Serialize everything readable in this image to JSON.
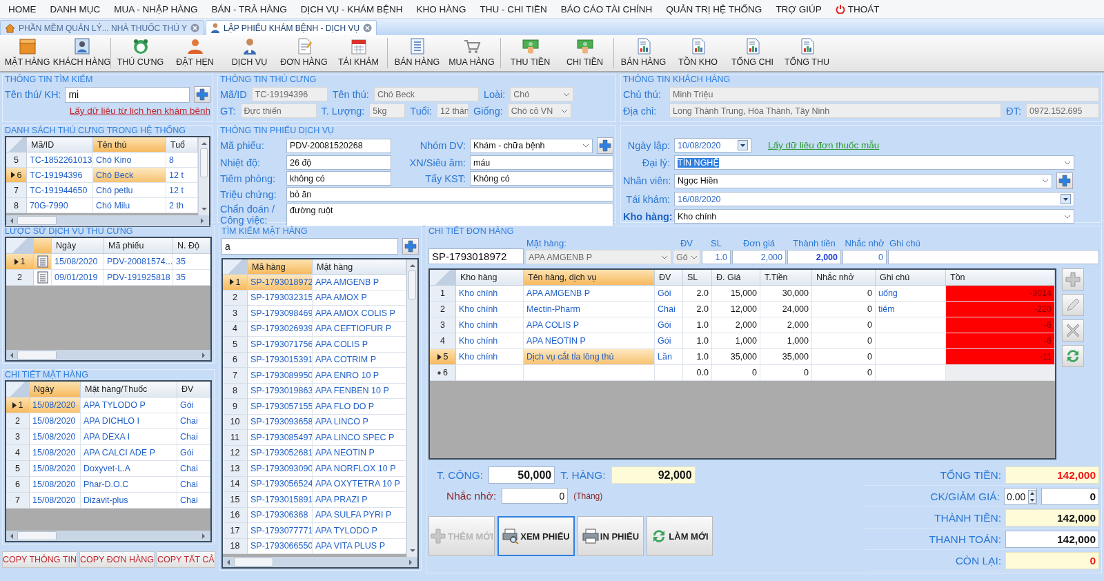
{
  "menu": {
    "items": [
      "HOME",
      "DANH MỤC",
      "MUA - NHẬP HÀNG",
      "BÁN - TRẢ HÀNG",
      "DỊCH VỤ - KHÁM BỆNH",
      "KHO HÀNG",
      "THU - CHI TIỀN",
      "BÁO CÁO TÀI CHÍNH",
      "QUẢN TRỊ HỆ THỐNG",
      "TRỢ GIÚP"
    ],
    "exit": "THOÁT"
  },
  "tabs": [
    {
      "label": "PHẦN MỀM QUẢN LÝ... NHÀ THUỐC THÚ Y",
      "kind": "home",
      "selected": false
    },
    {
      "label": "LẬP PHIẾU KHÁM BỆNH - DỊCH VỤ",
      "kind": "doctor",
      "selected": true
    }
  ],
  "toolbar": [
    [
      {
        "label": "MẶT HÀNG",
        "kind": "box"
      },
      {
        "label": "KHÁCH HÀNG",
        "kind": "card"
      }
    ],
    [
      {
        "label": "THÚ CƯNG",
        "kind": "pet"
      },
      {
        "label": "ĐẶT HẸN",
        "kind": "person"
      },
      {
        "label": "DỊCH VỤ",
        "kind": "doctor"
      },
      {
        "label": "ĐƠN HÀNG",
        "kind": "document"
      },
      {
        "label": "TÁI KHÁM",
        "kind": "calendar"
      }
    ],
    [
      {
        "label": "BÁN HÀNG",
        "kind": "list"
      },
      {
        "label": "MUA HÀNG",
        "kind": "cart"
      }
    ],
    [
      {
        "label": "THU TIỀN",
        "kind": "money"
      },
      {
        "label": "CHI TIỀN",
        "kind": "money"
      }
    ],
    [
      {
        "label": "BÁN HÀNG",
        "kind": "report"
      },
      {
        "label": "TỒN KHO",
        "kind": "report"
      },
      {
        "label": "TỔNG CHI",
        "kind": "report"
      },
      {
        "label": "TỔNG THU",
        "kind": "report"
      }
    ]
  ],
  "search_info": {
    "title": "THÔNG TIN TÌM KIẾM",
    "label": "Tên thú/ KH:",
    "value": "mi",
    "link": "Lấy dữ liêu từ lich hen khám bênh"
  },
  "pet_info": {
    "title": "THÔNG TIN THÚ CƯNG",
    "fields": [
      {
        "label": "Mã/ID",
        "value": "TC-19194396",
        "kind": "readonly"
      },
      {
        "label": "Tên thú:",
        "value": "Chó Beck",
        "kind": "readonly"
      },
      {
        "label": "Loài:",
        "value": "Chó",
        "kind": "readonly-select"
      },
      {
        "label": "GT:",
        "value": "Đực thiến",
        "kind": "readonly"
      },
      {
        "label": "T. Lượng:",
        "value": "5kg",
        "kind": "readonly"
      },
      {
        "label": "Tuổi:",
        "value": "12 thán",
        "kind": "readonly"
      },
      {
        "label": "Giống:",
        "value": "Chó cỏ VN",
        "kind": "readonly-select"
      }
    ]
  },
  "customer_info": {
    "title": "THÔNG TIN KHÁCH HÀNG",
    "fields": [
      {
        "label": "Chủ thú:",
        "value": "Minh Triệu",
        "kind": "readonly"
      },
      {
        "label": "Địa chỉ:",
        "value": "Long Thành Trung, Hòa Thành, Tây Ninh",
        "kind": "readonly"
      },
      {
        "label": "ĐT:",
        "value": "0972.152.695",
        "kind": "readonly"
      }
    ]
  },
  "pet_list": {
    "title": "DANH SÁCH THÚ CƯNG TRONG HỆ THỐNG",
    "columns": [
      {
        "label": "Mã/ID",
        "kind": "text",
        "current": false
      },
      {
        "label": "Tên thú",
        "kind": "text",
        "current": true
      },
      {
        "label": "Tuổ",
        "kind": "text",
        "current": false
      }
    ],
    "rows": [
      {
        "number": "5",
        "selected": false,
        "cells": [
          "TC-1852261013",
          "Chó Kino",
          "8"
        ]
      },
      {
        "number": "6",
        "selected": true,
        "cells": [
          "TC-19194396",
          "Chó Beck",
          "12 t"
        ]
      },
      {
        "number": "7",
        "selected": false,
        "cells": [
          "TC-191944650",
          "Chó petlu",
          "12 t"
        ]
      },
      {
        "number": "8",
        "selected": false,
        "cells": [
          "70G-7990",
          "Chó Milu",
          "2 th"
        ]
      }
    ]
  },
  "service_info": {
    "title": "THÔNG TIN PHIẾU DỊCH VỤ",
    "fields": [
      {
        "label": "Mã phiếu:",
        "value": "PDV-20081520268",
        "kind": "text"
      },
      {
        "label": "Nhóm DV:",
        "value": "Khám - chữa bệnh",
        "kind": "select",
        "add_button": true
      },
      {
        "label": "Nhiệt độ:",
        "value": "26 độ",
        "kind": "text"
      },
      {
        "label": "XN/Siêu âm:",
        "value": "máu",
        "kind": "text"
      },
      {
        "label": "Tiêm phòng:",
        "value": "không có",
        "kind": "text"
      },
      {
        "label": "Tẩy KST:",
        "value": "Không có",
        "kind": "text"
      },
      {
        "label": "Triệu chứng:",
        "value": "bỏ ăn",
        "kind": "text"
      },
      {
        "label": "Chẩn đoán / Công việc:",
        "value": "đường ruột",
        "kind": "textarea"
      }
    ],
    "template_link": "Lấy dữ liêu đơn thuốc mẫu",
    "right_fields": [
      {
        "label": "Ngày lập:",
        "value": "10/08/2020",
        "kind": "date"
      },
      {
        "label": "Đại lý:",
        "value": "TÍN NGHỆ",
        "kind": "select",
        "highlighted": true
      },
      {
        "label": "Nhân viên:",
        "value": "Ngọc Hiền",
        "kind": "select",
        "add_button": true
      },
      {
        "label": "Tái khám:",
        "value": "16/08/2020",
        "kind": "date"
      },
      {
        "label": "Kho hàng:",
        "value": "Kho chính",
        "kind": "select",
        "strong": true
      }
    ]
  },
  "history": {
    "title": "LƯỢC SỬ DỊCH VỤ THÚ CƯNG",
    "icon_column": {
      "current": true
    },
    "columns": [
      {
        "label": "Ngày",
        "kind": "text",
        "current": false
      },
      {
        "label": "Mã phiếu",
        "kind": "text",
        "current": false
      },
      {
        "label": "N. Độ",
        "kind": "text",
        "current": false
      }
    ],
    "rows": [
      {
        "number": "1",
        "selected": true,
        "cells": [
          "15/08/2020",
          "PDV-20081574...",
          "35"
        ]
      },
      {
        "number": "2",
        "selected": false,
        "cells": [
          "09/01/2019",
          "PDV-191925818",
          "35"
        ]
      }
    ]
  },
  "item_details": {
    "title": "CHI TIẾT MẶT HÀNG",
    "columns": [
      {
        "label": "Ngày",
        "kind": "text",
        "current": true
      },
      {
        "label": "Mặt hàng/Thuốc",
        "kind": "text",
        "current": false
      },
      {
        "label": "ĐV",
        "kind": "text",
        "current": false
      }
    ],
    "rows": [
      {
        "number": "1",
        "selected": true,
        "cells": [
          "15/08/2020",
          "APA TYLODO P",
          "Gói"
        ]
      },
      {
        "number": "2",
        "selected": false,
        "cells": [
          "15/08/2020",
          "APA DICHLO I",
          "Chai"
        ]
      },
      {
        "number": "3",
        "selected": false,
        "cells": [
          "15/08/2020",
          "APA DEXA I",
          "Chai"
        ]
      },
      {
        "number": "4",
        "selected": false,
        "cells": [
          "15/08/2020",
          "APA CALCI ADE P",
          "Gói"
        ]
      },
      {
        "number": "5",
        "selected": false,
        "cells": [
          "15/08/2020",
          "Doxyvet-L.A",
          "Chai"
        ]
      },
      {
        "number": "6",
        "selected": false,
        "cells": [
          "15/08/2020",
          "Phar-D.O.C",
          "Chai"
        ]
      },
      {
        "number": "7",
        "selected": false,
        "cells": [
          "15/08/2020",
          "Dizavit-plus",
          "Chai"
        ]
      }
    ]
  },
  "copy_buttons": [
    "COPY THÔNG TIN",
    "COPY ĐƠN HÀNG",
    "COPY TẤT CẢ"
  ],
  "item_search": {
    "title": "TÌM KIẾM MẶT HÀNG",
    "value": "a",
    "columns": [
      {
        "label": "Mã hàng",
        "kind": "text",
        "current": true
      },
      {
        "label": "Mặt hàng",
        "kind": "text",
        "current": false
      }
    ],
    "rows": [
      {
        "number": "1",
        "selected": true,
        "cells": [
          "SP-1793018972",
          "APA AMGENB P"
        ]
      },
      {
        "number": "2",
        "selected": false,
        "cells": [
          "SP-1793032315",
          "APA AMOX P"
        ]
      },
      {
        "number": "3",
        "selected": false,
        "cells": [
          "SP-1793098469",
          "APA AMOX COLIS P"
        ]
      },
      {
        "number": "4",
        "selected": false,
        "cells": [
          "SP-1793026939",
          "APA CEFTIOFUR P"
        ]
      },
      {
        "number": "5",
        "selected": false,
        "cells": [
          "SP-1793071756",
          "APA COLIS P"
        ]
      },
      {
        "number": "6",
        "selected": false,
        "cells": [
          "SP-1793015391",
          "APA COTRIM P"
        ]
      },
      {
        "number": "7",
        "selected": false,
        "cells": [
          "SP-1793089950",
          "APA ENRO 10 P"
        ]
      },
      {
        "number": "8",
        "selected": false,
        "cells": [
          "SP-1793019863",
          "APA FENBEN 10 P"
        ]
      },
      {
        "number": "9",
        "selected": false,
        "cells": [
          "SP-1793057155",
          "APA FLO DO P"
        ]
      },
      {
        "number": "10",
        "selected": false,
        "cells": [
          "SP-1793093658",
          "APA LINCO P"
        ]
      },
      {
        "number": "11",
        "selected": false,
        "cells": [
          "SP-1793085497",
          "APA LINCO SPEC P"
        ]
      },
      {
        "number": "12",
        "selected": false,
        "cells": [
          "SP-1793052681",
          "APA NEOTIN P"
        ]
      },
      {
        "number": "13",
        "selected": false,
        "cells": [
          "SP-1793093090",
          "APA NORFLOX 10 P"
        ]
      },
      {
        "number": "14",
        "selected": false,
        "cells": [
          "SP-1793056524",
          "APA OXYTETRA 10 P"
        ]
      },
      {
        "number": "15",
        "selected": false,
        "cells": [
          "SP-1793015891",
          "APA PRAZI P"
        ]
      },
      {
        "number": "16",
        "selected": false,
        "cells": [
          "SP-179306368",
          "APA SULFA PYRI P"
        ]
      },
      {
        "number": "17",
        "selected": false,
        "cells": [
          "SP-1793077771",
          "APA TYLODO P"
        ]
      },
      {
        "number": "18",
        "selected": false,
        "cells": [
          "SP-1793066550",
          "APA VITA PLUS P"
        ]
      }
    ]
  },
  "order": {
    "title": "CHI TIẾT ĐƠN HÀNG",
    "entry": {
      "code": "SP-1793018972",
      "fields": [
        {
          "label": "Mặt hàng:",
          "value": "APA AMGENB P",
          "kind": "readonly-select"
        },
        {
          "label": "ĐV",
          "value": "Gó",
          "kind": "readonly-select"
        },
        {
          "label": "SL",
          "value": "1.0",
          "kind": "number"
        },
        {
          "label": "Đơn giá",
          "value": "2,000",
          "kind": "number"
        },
        {
          "label": "Thành tiền",
          "value": "2,000",
          "kind": "total"
        },
        {
          "label": "Nhắc nhở",
          "value": "0",
          "kind": "number"
        },
        {
          "label": "Ghi chú",
          "kind": "text"
        }
      ]
    },
    "columns": [
      {
        "label": "Kho hàng",
        "kind": "text",
        "current": false
      },
      {
        "label": "Tên hàng, dịch vụ",
        "kind": "text",
        "current": true
      },
      {
        "label": "ĐV",
        "kind": "text",
        "current": false
      },
      {
        "label": "SL",
        "kind": "number",
        "current": false
      },
      {
        "label": "Đ. Giá",
        "kind": "number",
        "current": false
      },
      {
        "label": "T.Tiền",
        "kind": "number",
        "current": false
      },
      {
        "label": "Nhắc nhở",
        "kind": "number",
        "current": false
      },
      {
        "label": "Ghi chú",
        "kind": "text",
        "current": false
      },
      {
        "label": "Tồn",
        "kind": "stock",
        "current": false
      }
    ],
    "rows": [
      {
        "number": "1",
        "selected": false,
        "kind": "item",
        "cells": [
          "Kho chính",
          "APA AMGENB P",
          "Gói",
          "2.0",
          "15,000",
          "30,000",
          "0",
          "uống",
          "-3014"
        ]
      },
      {
        "number": "2",
        "selected": false,
        "kind": "item",
        "cells": [
          "Kho chính",
          "Mectin-Pharm",
          "Chai",
          "2.0",
          "12,000",
          "24,000",
          "0",
          "tiêm",
          "-220"
        ]
      },
      {
        "number": "3",
        "selected": false,
        "kind": "item",
        "cells": [
          "Kho chính",
          "APA COLIS P",
          "Gói",
          "1.0",
          "2,000",
          "2,000",
          "0",
          null,
          "-6"
        ]
      },
      {
        "number": "4",
        "selected": false,
        "kind": "item",
        "cells": [
          "Kho chính",
          "APA NEOTIN P",
          "Gói",
          "1.0",
          "1,000",
          "1,000",
          "0",
          null,
          "-6"
        ]
      },
      {
        "number": "5",
        "selected": true,
        "kind": "item",
        "cells": [
          "Kho chính",
          "Dịch vụ cắt tỉa lông thú",
          "Lần",
          "1.0",
          "35,000",
          "35,000",
          "0",
          null,
          "-11"
        ]
      },
      {
        "number": "6",
        "selected": false,
        "kind": "new",
        "cells": [
          null,
          null,
          null,
          "0.0",
          "0",
          "0",
          "0",
          null,
          null
        ]
      }
    ],
    "side_buttons": [
      {
        "kind": "add"
      },
      {
        "kind": "edit"
      },
      {
        "kind": "delete"
      },
      {
        "kind": "refresh"
      }
    ]
  },
  "totals": {
    "labor": {
      "label": "T. CÔNG:",
      "value": "50,000"
    },
    "goods": {
      "label": "T. HÀNG:",
      "value": "92,000"
    },
    "reminder": {
      "label": "Nhắc nhở:",
      "value": "0",
      "unit": "(Tháng)"
    },
    "summary": [
      {
        "label": "TỔNG TIỀN:",
        "value": "142,000",
        "kind": "due"
      },
      {
        "label": "CK/GIẢM GIÁ:",
        "percent": "0.00",
        "value": "0",
        "kind": "discount"
      },
      {
        "label": "THÀNH TIỀN:",
        "value": "142,000",
        "kind": "sum"
      },
      {
        "label": "THANH TOÁN:",
        "value": "142,000",
        "kind": "input"
      },
      {
        "label": "CÒN LẠI:",
        "value": "0",
        "kind": "due"
      }
    ]
  },
  "actions": [
    {
      "label": "THÊM MỚI",
      "kind": "add",
      "disabled": true,
      "focused": false
    },
    {
      "label": "XEM PHIẾU",
      "kind": "view",
      "disabled": false,
      "focused": true
    },
    {
      "label": "IN PHIẾU",
      "kind": "print",
      "disabled": false,
      "focused": false
    },
    {
      "label": "LÀM MỚI",
      "kind": "refresh",
      "disabled": false,
      "focused": false
    }
  ]
}
